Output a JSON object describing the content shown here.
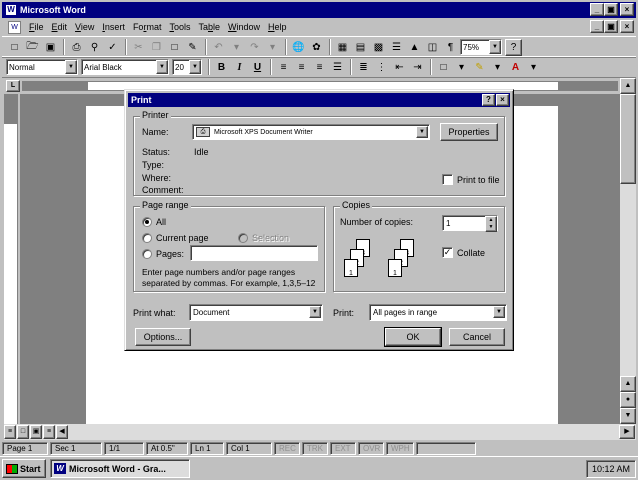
{
  "app": {
    "title": "Microsoft Word",
    "caption_buttons": [
      "_",
      "ą",
      "×"
    ],
    "doc_caption_buttons": [
      "_",
      "ą",
      "×"
    ]
  },
  "menu": {
    "items": [
      {
        "first": "F",
        "rest": "ile"
      },
      {
        "first": "E",
        "rest": "dit"
      },
      {
        "first": "V",
        "rest": "iew"
      },
      {
        "first": "I",
        "rest": "nsert"
      },
      {
        "first": "Fo",
        "u": "r",
        "rest": "mat"
      },
      {
        "first": "T",
        "rest": "ools"
      },
      {
        "first": "Ta",
        "u": "b",
        "rest": "le"
      },
      {
        "first": "W",
        "rest": "indow"
      },
      {
        "first": "H",
        "rest": "elp"
      }
    ]
  },
  "toolbar": {
    "zoom": "75%",
    "help_icon": "?",
    "paragraph_mark": "¶"
  },
  "formatting": {
    "style": "Normal",
    "font": "Arial Black",
    "size": "20",
    "bold": "B",
    "italic": "I",
    "underline": "U"
  },
  "ruler": {
    "corner": "L"
  },
  "dialog": {
    "title": "Print",
    "title_buttons": [
      "?",
      "×"
    ],
    "printer": {
      "group_label": "Printer",
      "name_label": "Name:",
      "name_value": "Microsoft XPS Document Writer",
      "properties_label": "Properties",
      "status_label": "Status:",
      "status_value": "Idle",
      "type_label": "Type:",
      "where_label": "Where:",
      "comment_label": "Comment:",
      "print_to_file_label": "Print to file",
      "print_to_file_checked": false
    },
    "page_range": {
      "group_label": "Page range",
      "all_label": "All",
      "current_page_label": "Current page",
      "selection_label": "Selection",
      "pages_label": "Pages:",
      "pages_value": "",
      "hint": "Enter page numbers and/or page ranges separated by commas.  For example, 1,3,5–12",
      "selected": "all"
    },
    "copies": {
      "group_label": "Copies",
      "number_label": "Number of copies:",
      "number_value": "1",
      "collate_label": "Collate",
      "collate_checked": true,
      "stack_labels": [
        "3",
        "2",
        "1"
      ]
    },
    "print_what": {
      "label": "Print what:",
      "value": "Document"
    },
    "print": {
      "label": "Print:",
      "value": "All pages in range"
    },
    "options_label": "Options...",
    "ok_label": "OK",
    "cancel_label": "Cancel"
  },
  "status_bar": {
    "page": "Page  1",
    "sec": "Sec  1",
    "count": "1/1",
    "at": "At  0.5\"",
    "ln": "Ln  1",
    "col": "Col  1",
    "rec": "REC",
    "trk": "TRK",
    "ext": "EXT",
    "ovr": "OVR",
    "wph": "WPH"
  },
  "taskbar": {
    "start_label": "Start",
    "task_label": "Microsoft Word - Gra...",
    "clock": "10:12 AM"
  }
}
